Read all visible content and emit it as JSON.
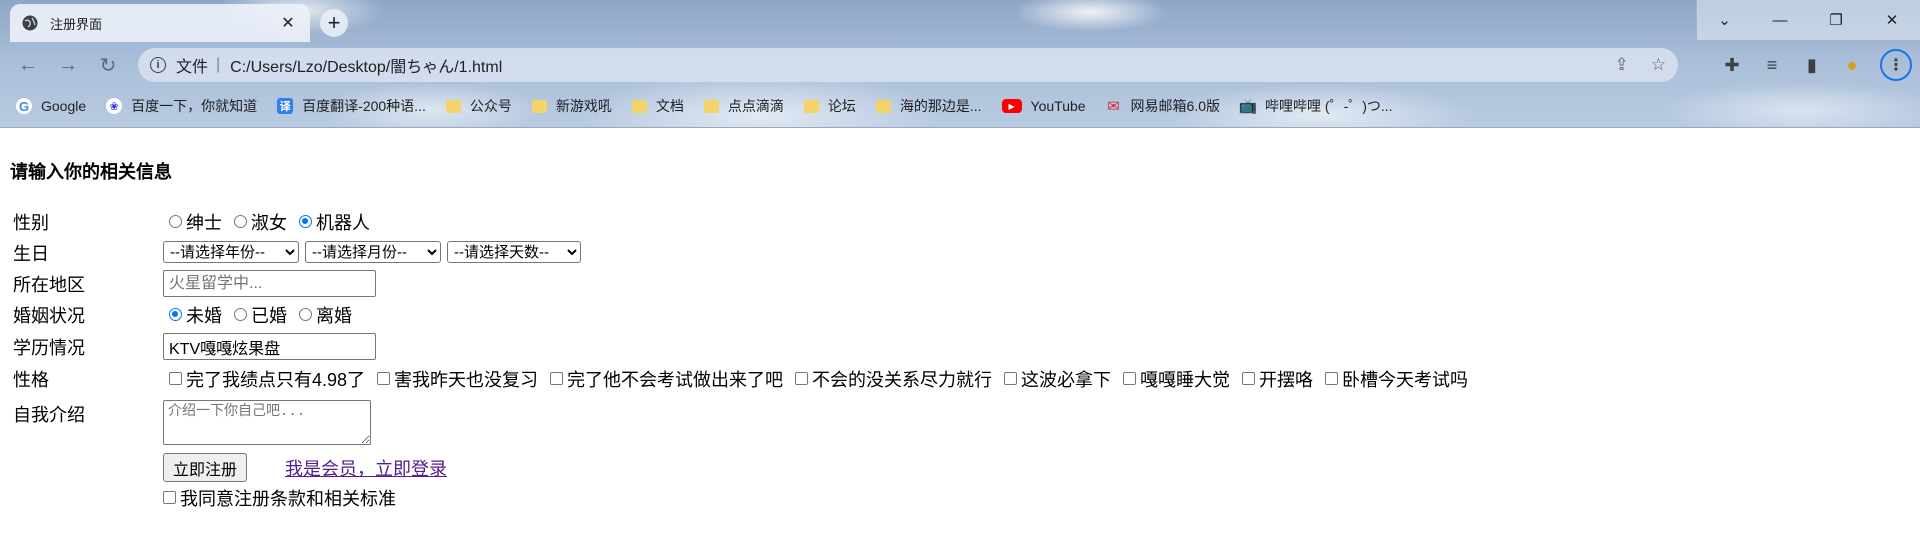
{
  "browser": {
    "tab_title": "注册界面",
    "tab_close": "✕",
    "new_tab": "+",
    "window": {
      "dropdown": "⌄",
      "minimize": "—",
      "restore": "❐",
      "close": "✕"
    },
    "address_label": "文件",
    "address_sep": "|",
    "address_url": "C:/Users/Lzo/Desktop/闇ちゃん/1.html",
    "bookmarks": [
      {
        "label": "Google",
        "icon": "google-icon"
      },
      {
        "label": "百度一下，你就知道",
        "icon": "baidu-icon"
      },
      {
        "label": "百度翻译-200种语...",
        "icon": "translate-icon"
      },
      {
        "label": "公众号",
        "icon": "folder-icon"
      },
      {
        "label": "新游戏吼",
        "icon": "folder-icon"
      },
      {
        "label": "文档",
        "icon": "folder-icon"
      },
      {
        "label": "点点滴滴",
        "icon": "folder-icon"
      },
      {
        "label": "论坛",
        "icon": "folder-icon"
      },
      {
        "label": "海的那边是...",
        "icon": "folder-icon"
      },
      {
        "label": "YouTube",
        "icon": "youtube-icon"
      },
      {
        "label": "网易邮箱6.0版",
        "icon": "netease-icon"
      },
      {
        "label": "哔哩哔哩 (゜-゜)つ...",
        "icon": "bilibili-icon"
      }
    ]
  },
  "form": {
    "heading": "请输入你的相关信息",
    "gender": {
      "label": "性别",
      "options": [
        "绅士",
        "淑女",
        "机器人"
      ],
      "selected": "机器人"
    },
    "birthday": {
      "label": "生日",
      "year": "--请选择年份--",
      "month": "--请选择月份--",
      "day": "--请选择天数--"
    },
    "region": {
      "label": "所在地区",
      "placeholder": "火星留学中..."
    },
    "marital": {
      "label": "婚姻状况",
      "options": [
        "未婚",
        "已婚",
        "离婚"
      ],
      "selected": "未婚"
    },
    "education": {
      "label": "学历情况",
      "value": "KTV嘎嘎炫果盘"
    },
    "personality": {
      "label": "性格",
      "options": [
        "完了我绩点只有4.98了",
        "害我昨天也没复习",
        "完了他不会考试做出来了吧",
        "不会的没关系尽力就行",
        "这波必拿下",
        "嘎嘎睡大觉",
        "开摆咯",
        "卧槽今天考试吗"
      ]
    },
    "intro": {
      "label": "自我介绍",
      "placeholder": "介绍一下你自己吧..."
    },
    "register_button": "立即注册",
    "login_link": "我是会员，立即登录",
    "agree": "我同意注册条款和相关标准"
  }
}
